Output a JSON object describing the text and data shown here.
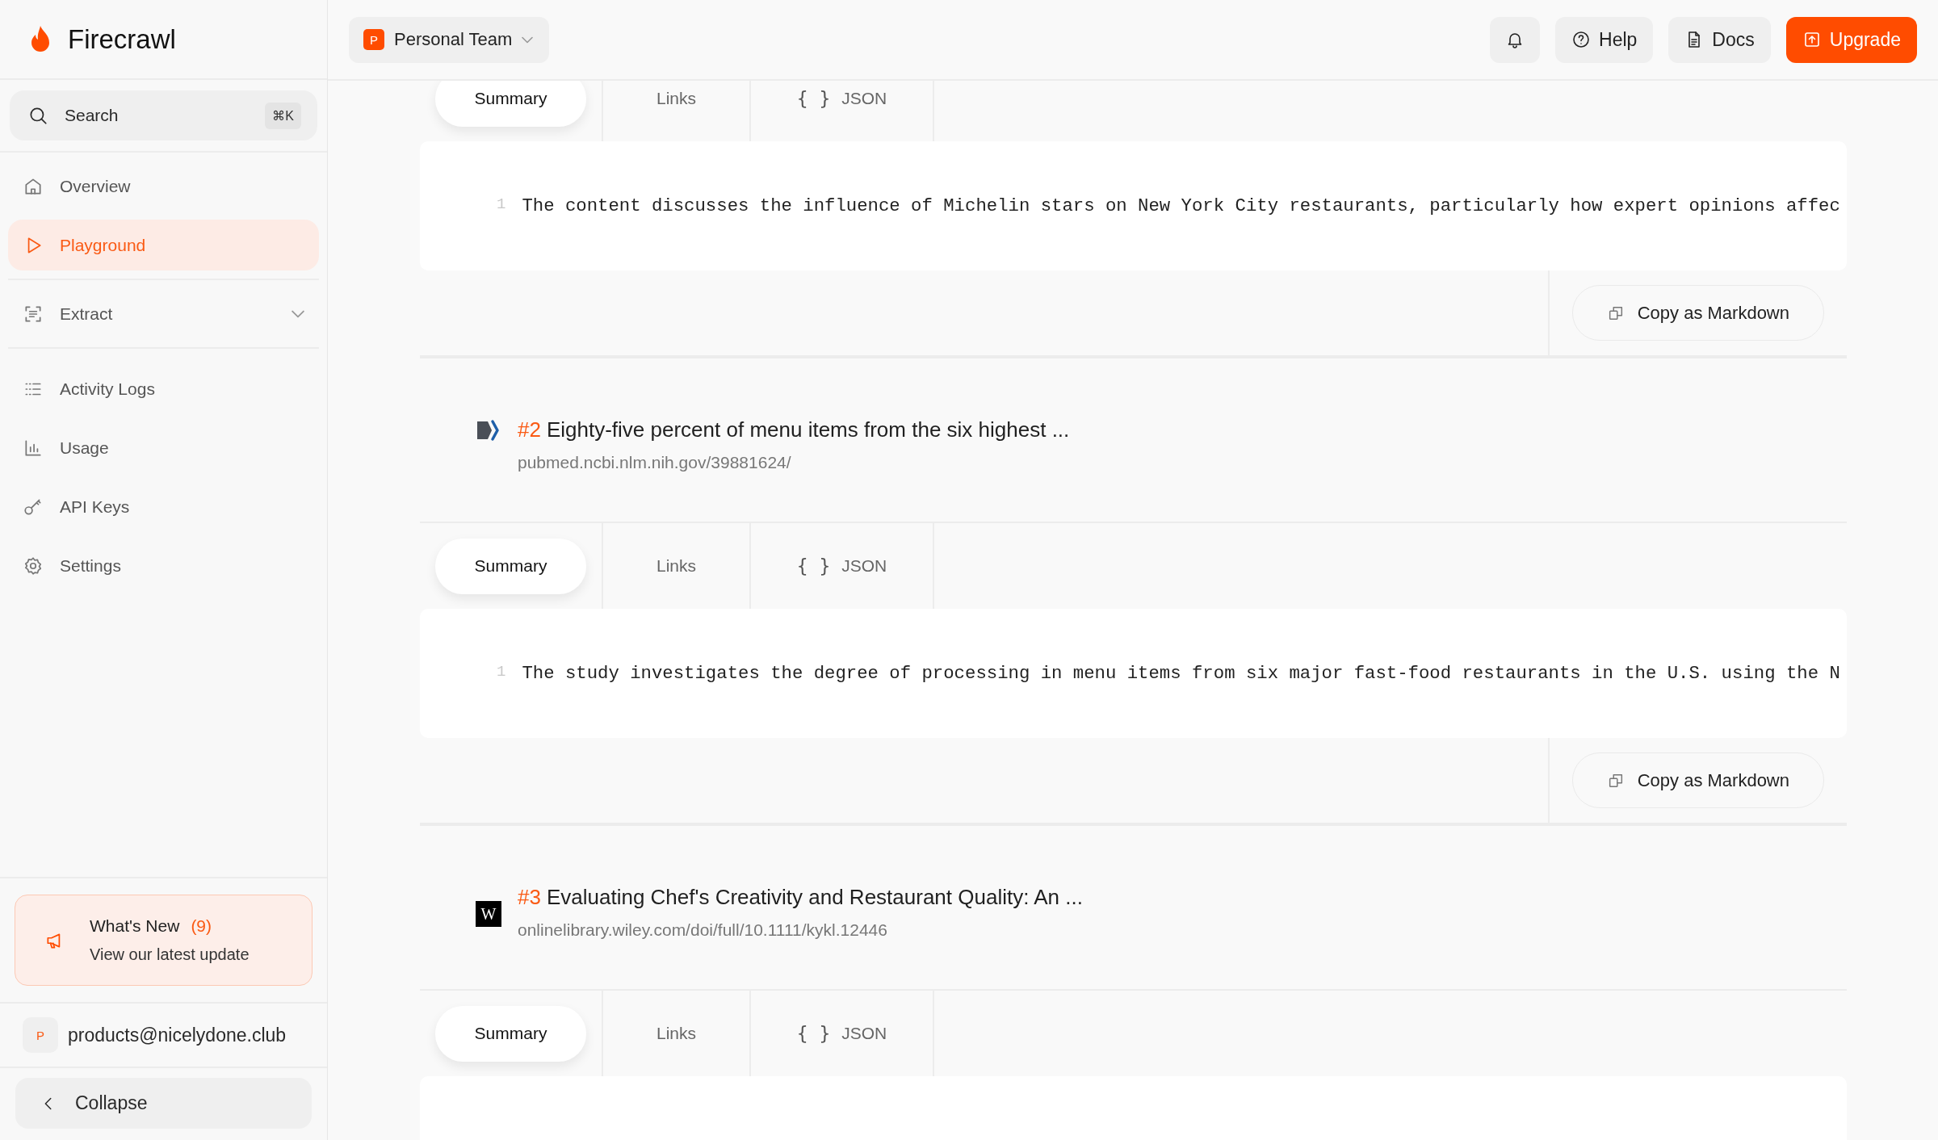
{
  "sidebar": {
    "brand": "Firecrawl",
    "search": {
      "placeholder": "Search",
      "shortcut": "⌘K"
    },
    "nav_groups": [
      {
        "items": [
          {
            "label": "Overview",
            "selected": false
          },
          {
            "label": "Playground",
            "selected": true
          }
        ]
      },
      {
        "items": [
          {
            "label": "Extract",
            "selected": false,
            "expanded": false
          }
        ]
      },
      {
        "items": [
          {
            "label": "Activity Logs",
            "selected": false
          },
          {
            "label": "Usage",
            "selected": false
          },
          {
            "label": "API Keys",
            "selected": false
          },
          {
            "label": "Settings",
            "selected": false
          }
        ]
      }
    ],
    "whats_new": {
      "title": "What's New",
      "count": "(9)",
      "subtitle": "View our latest update"
    },
    "account": {
      "avatar": "P",
      "email": "products@nicelydone.club"
    },
    "collapse": "Collapse"
  },
  "topbar": {
    "team": {
      "badge": "P",
      "name": "Personal Team"
    },
    "buttons": [
      {
        "kind": "icon"
      },
      {
        "kind": "ghost",
        "label": "Help"
      },
      {
        "kind": "ghost",
        "label": "Docs"
      },
      {
        "kind": "primary",
        "label": "Upgrade"
      }
    ]
  },
  "results": [
    {
      "tabs": [
        {
          "label": "Summary",
          "selected": true
        },
        {
          "label": "Links",
          "selected": false
        },
        {
          "label": "JSON",
          "icon": "{ }",
          "selected": false
        }
      ],
      "lines": [
        {
          "number": "1",
          "text": "The content discusses the influence of Michelin stars on New York City restaurants, particularly how expert opinions affec"
        }
      ],
      "copy_label": "Copy as Markdown"
    },
    {
      "rank": "#2",
      "title": "Eighty-five percent of menu items from the six highest ...",
      "url": "pubmed.ncbi.nlm.nih.gov/39881624/",
      "favicon": {
        "kind": "chevron"
      },
      "tabs": [
        {
          "label": "Summary",
          "selected": true
        },
        {
          "label": "Links",
          "selected": false
        },
        {
          "label": "JSON",
          "icon": "{ }",
          "selected": false
        }
      ],
      "lines": [
        {
          "number": "1",
          "text": "The study investigates the degree of processing in menu items from six major fast-food restaurants in the U.S. using the N"
        }
      ],
      "copy_label": "Copy as Markdown"
    },
    {
      "rank": "#3",
      "title": "Evaluating Chef's Creativity and Restaurant Quality: An ...",
      "url": "onlinelibrary.wiley.com/doi/full/10.1111/kykl.12446",
      "favicon": {
        "kind": "letter",
        "text": "W"
      },
      "tabs": [
        {
          "label": "Summary",
          "selected": true
        },
        {
          "label": "Links",
          "selected": false
        },
        {
          "label": "JSON",
          "icon": "{ }",
          "selected": false
        }
      ]
    }
  ]
}
